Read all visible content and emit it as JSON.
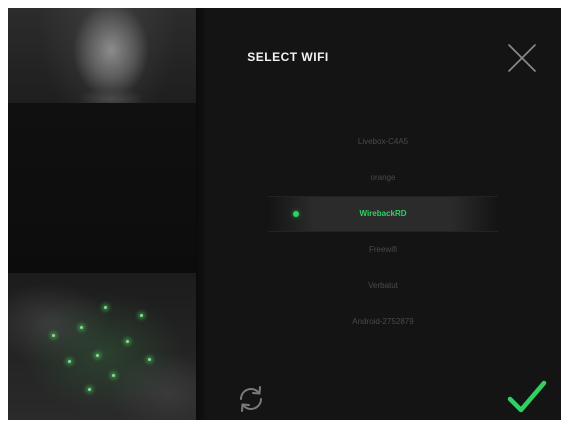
{
  "header": {
    "title": "SELECT WIFI"
  },
  "networks": [
    {
      "ssid": "Livebox-C4A5",
      "selected": false
    },
    {
      "ssid": "orange",
      "selected": false
    },
    {
      "ssid": "WirebackRD",
      "selected": true
    },
    {
      "ssid": "Freewifi",
      "selected": false
    },
    {
      "ssid": "Verbatut",
      "selected": false
    },
    {
      "ssid": "Android-2752879",
      "selected": false
    }
  ],
  "icons": {
    "close": "close-icon",
    "refresh": "refresh-icon",
    "confirm": "checkmark-icon",
    "selected_indicator": "dot-icon"
  },
  "colors": {
    "background": "#141414",
    "accent": "#2fd162",
    "title_text": "#f2f2f2",
    "inactive_text": "#4a4a4a",
    "icon_gray": "#8a8a8a"
  }
}
